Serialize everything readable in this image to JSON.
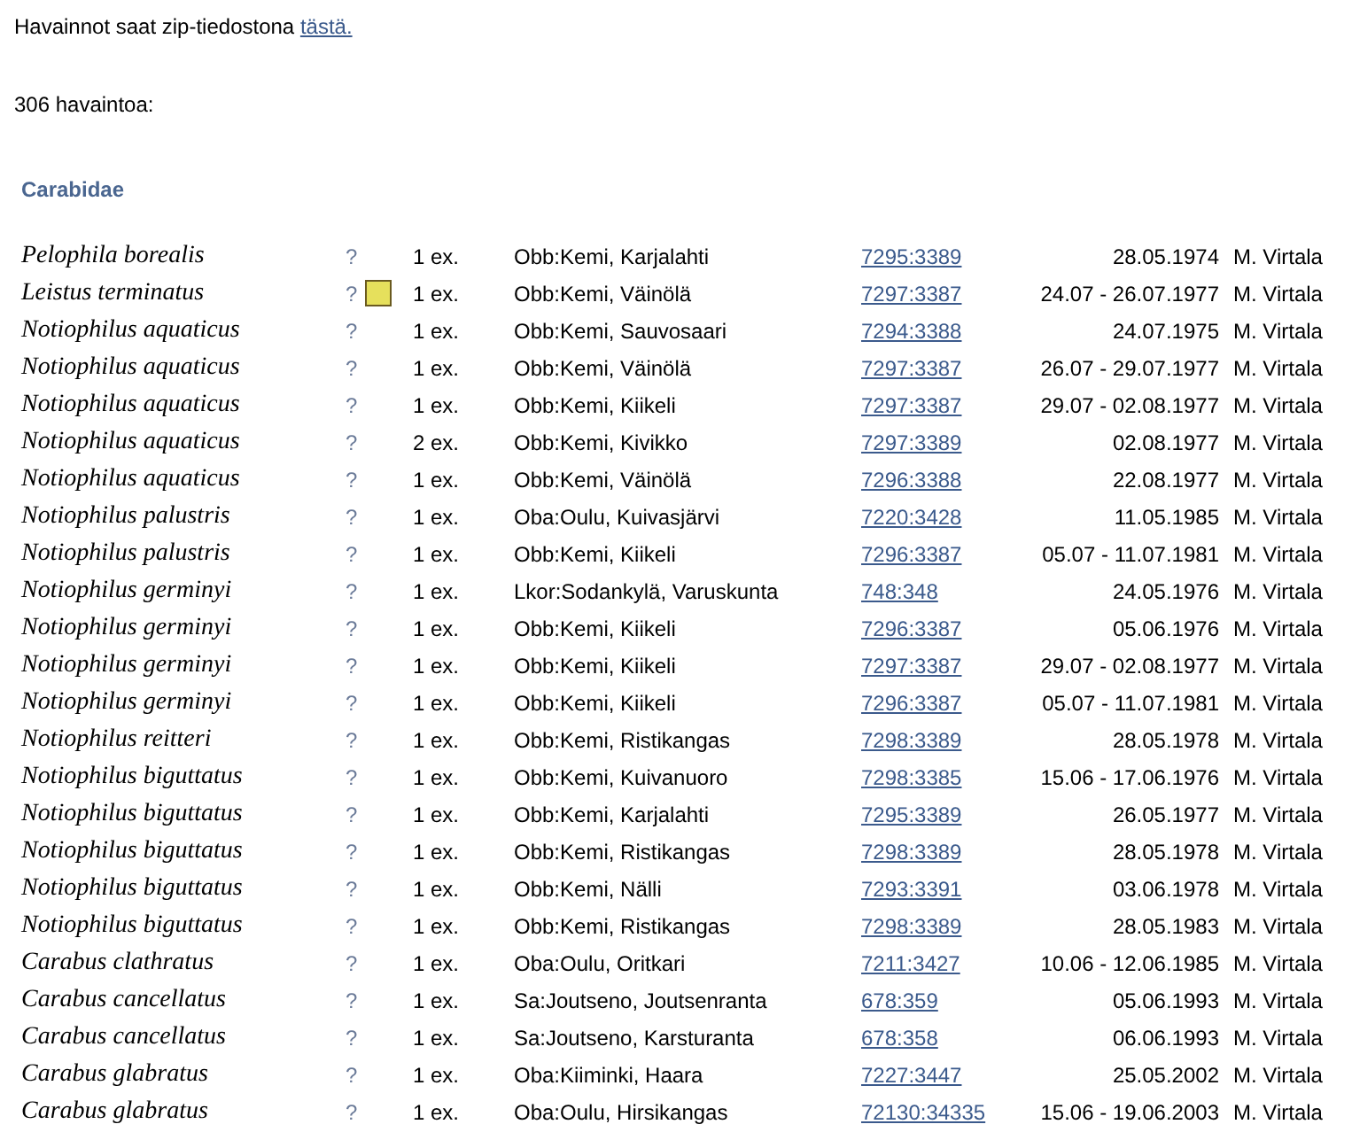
{
  "intro": {
    "text": "Havainnot saat zip-tiedostona ",
    "link": "tästä."
  },
  "count": "306 havaintoa:",
  "family": "Carabidae",
  "rows": [
    {
      "species": "Pelophila borealis",
      "query": "?",
      "marked": false,
      "amount": "1 ex.",
      "locality": "Obb:Kemi, Karjalahti",
      "coords": "7295:3389",
      "date": "28.05.1974",
      "observer": "M. Virtala"
    },
    {
      "species": "Leistus terminatus",
      "query": "?",
      "marked": true,
      "amount": "1 ex.",
      "locality": "Obb:Kemi, Väinölä",
      "coords": "7297:3387",
      "date": "24.07 - 26.07.1977",
      "observer": "M. Virtala"
    },
    {
      "species": "Notiophilus aquaticus",
      "query": "?",
      "marked": false,
      "amount": "1 ex.",
      "locality": "Obb:Kemi, Sauvosaari",
      "coords": "7294:3388",
      "date": "24.07.1975",
      "observer": "M. Virtala"
    },
    {
      "species": "Notiophilus aquaticus",
      "query": "?",
      "marked": false,
      "amount": "1 ex.",
      "locality": "Obb:Kemi, Väinölä",
      "coords": "7297:3387",
      "date": "26.07 - 29.07.1977",
      "observer": "M. Virtala"
    },
    {
      "species": "Notiophilus aquaticus",
      "query": "?",
      "marked": false,
      "amount": "1 ex.",
      "locality": "Obb:Kemi, Kiikeli",
      "coords": "7297:3387",
      "date": "29.07 - 02.08.1977",
      "observer": "M. Virtala"
    },
    {
      "species": "Notiophilus aquaticus",
      "query": "?",
      "marked": false,
      "amount": "2 ex.",
      "locality": "Obb:Kemi, Kivikko",
      "coords": "7297:3389",
      "date": "02.08.1977",
      "observer": "M. Virtala"
    },
    {
      "species": "Notiophilus aquaticus",
      "query": "?",
      "marked": false,
      "amount": "1 ex.",
      "locality": "Obb:Kemi, Väinölä",
      "coords": "7296:3388",
      "date": "22.08.1977",
      "observer": "M. Virtala"
    },
    {
      "species": "Notiophilus palustris",
      "query": "?",
      "marked": false,
      "amount": "1 ex.",
      "locality": "Oba:Oulu, Kuivasjärvi",
      "coords": "7220:3428",
      "date": "11.05.1985",
      "observer": "M. Virtala"
    },
    {
      "species": "Notiophilus palustris",
      "query": "?",
      "marked": false,
      "amount": "1 ex.",
      "locality": "Obb:Kemi, Kiikeli",
      "coords": "7296:3387",
      "date": "05.07 - 11.07.1981",
      "observer": "M. Virtala"
    },
    {
      "species": "Notiophilus germinyi",
      "query": "?",
      "marked": false,
      "amount": "1 ex.",
      "locality": "Lkor:Sodankylä, Varuskunta",
      "coords": "748:348",
      "date": "24.05.1976",
      "observer": "M. Virtala"
    },
    {
      "species": "Notiophilus germinyi",
      "query": "?",
      "marked": false,
      "amount": "1 ex.",
      "locality": "Obb:Kemi, Kiikeli",
      "coords": "7296:3387",
      "date": "05.06.1976",
      "observer": "M. Virtala"
    },
    {
      "species": "Notiophilus germinyi",
      "query": "?",
      "marked": false,
      "amount": "1 ex.",
      "locality": "Obb:Kemi, Kiikeli",
      "coords": "7297:3387",
      "date": "29.07 - 02.08.1977",
      "observer": "M. Virtala"
    },
    {
      "species": "Notiophilus germinyi",
      "query": "?",
      "marked": false,
      "amount": "1 ex.",
      "locality": "Obb:Kemi, Kiikeli",
      "coords": "7296:3387",
      "date": "05.07 - 11.07.1981",
      "observer": "M. Virtala"
    },
    {
      "species": "Notiophilus reitteri",
      "query": "?",
      "marked": false,
      "amount": "1 ex.",
      "locality": "Obb:Kemi, Ristikangas",
      "coords": "7298:3389",
      "date": "28.05.1978",
      "observer": "M. Virtala"
    },
    {
      "species": "Notiophilus biguttatus",
      "query": "?",
      "marked": false,
      "amount": "1 ex.",
      "locality": "Obb:Kemi, Kuivanuoro",
      "coords": "7298:3385",
      "date": "15.06 - 17.06.1976",
      "observer": "M. Virtala"
    },
    {
      "species": "Notiophilus biguttatus",
      "query": "?",
      "marked": false,
      "amount": "1 ex.",
      "locality": "Obb:Kemi, Karjalahti",
      "coords": "7295:3389",
      "date": "26.05.1977",
      "observer": "M. Virtala"
    },
    {
      "species": "Notiophilus biguttatus",
      "query": "?",
      "marked": false,
      "amount": "1 ex.",
      "locality": "Obb:Kemi, Ristikangas",
      "coords": "7298:3389",
      "date": "28.05.1978",
      "observer": "M. Virtala"
    },
    {
      "species": "Notiophilus biguttatus",
      "query": "?",
      "marked": false,
      "amount": "1 ex.",
      "locality": "Obb:Kemi, Nälli",
      "coords": "7293:3391",
      "date": "03.06.1978",
      "observer": "M. Virtala"
    },
    {
      "species": "Notiophilus biguttatus",
      "query": "?",
      "marked": false,
      "amount": "1 ex.",
      "locality": "Obb:Kemi, Ristikangas",
      "coords": "7298:3389",
      "date": "28.05.1983",
      "observer": "M. Virtala"
    },
    {
      "species": "Carabus clathratus",
      "query": "?",
      "marked": false,
      "amount": "1 ex.",
      "locality": "Oba:Oulu, Oritkari",
      "coords": "7211:3427",
      "date": "10.06 - 12.06.1985",
      "observer": "M. Virtala"
    },
    {
      "species": "Carabus cancellatus",
      "query": "?",
      "marked": false,
      "amount": "1 ex.",
      "locality": "Sa:Joutseno, Joutsenranta",
      "coords": "678:359",
      "date": "05.06.1993",
      "observer": "M. Virtala"
    },
    {
      "species": "Carabus cancellatus",
      "query": "?",
      "marked": false,
      "amount": "1 ex.",
      "locality": "Sa:Joutseno, Karsturanta",
      "coords": "678:358",
      "date": "06.06.1993",
      "observer": "M. Virtala"
    },
    {
      "species": "Carabus glabratus",
      "query": "?",
      "marked": false,
      "amount": "1 ex.",
      "locality": "Oba:Kiiminki, Haara",
      "coords": "7227:3447",
      "date": "25.05.2002",
      "observer": "M. Virtala"
    },
    {
      "species": "Carabus glabratus",
      "query": "?",
      "marked": false,
      "amount": "1 ex.",
      "locality": "Oba:Oulu, Hirsikangas",
      "coords": "72130:34335",
      "date": "15.06 - 19.06.2003",
      "observer": "M. Virtala"
    }
  ]
}
